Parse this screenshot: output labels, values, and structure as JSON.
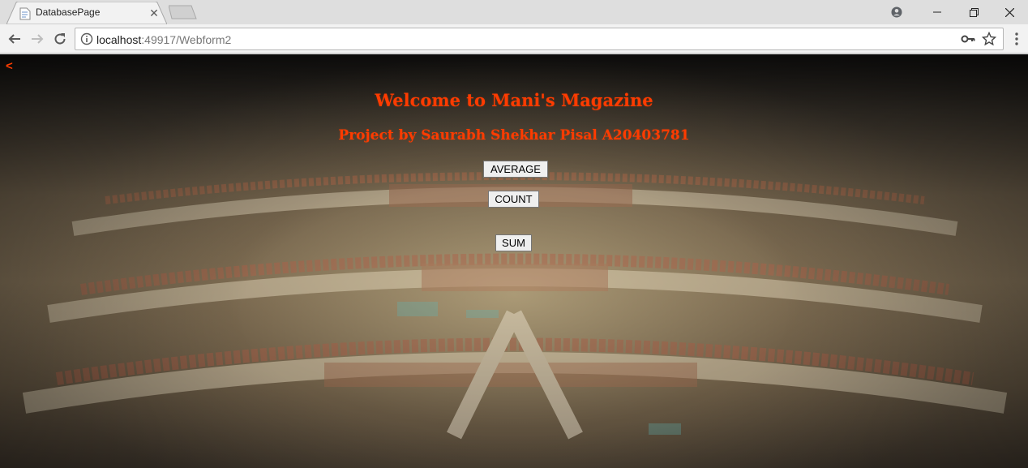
{
  "browser": {
    "tab_title": "DatabasePage",
    "url_host": "localhost",
    "url_rest": ":49917/Webform2"
  },
  "page": {
    "back_link": "<",
    "title": "Welcome to Mani's Magazine",
    "subtitle": "Project by Saurabh Shekhar Pisal A20403781",
    "buttons": {
      "average": "AVERAGE",
      "count": "COUNT",
      "sum": "SUM"
    }
  },
  "colors": {
    "heading": "#ff3b00",
    "back_link": "#ff3d00"
  },
  "icons": {
    "page-favicon": "document",
    "info": "circle-i",
    "key": "key",
    "star": "star-outline"
  }
}
